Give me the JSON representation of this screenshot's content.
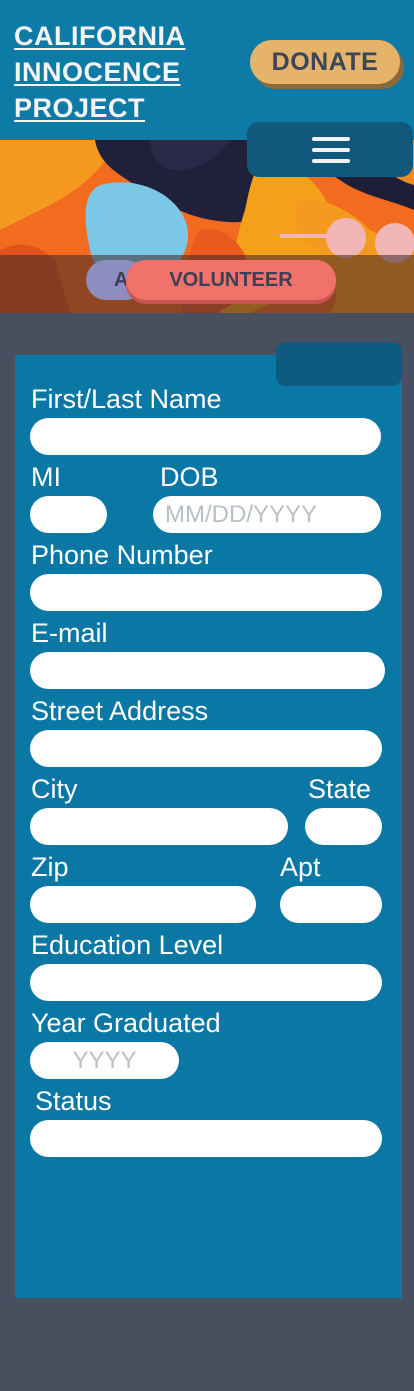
{
  "header": {
    "logo_lines": [
      "CALIFORNIA",
      "INNOCENCE",
      "PROJECT"
    ],
    "donate_label": "DONATE",
    "menu_icon": "hamburger-menu-icon"
  },
  "hero": {
    "tab_partial_label": "A",
    "volunteer_label": "VOLUNTEER"
  },
  "form": {
    "name_label": "First/Last Name",
    "mi_label": "MI",
    "dob_label": "DOB",
    "dob_placeholder": "MM/DD/YYYY",
    "phone_label": "Phone Number",
    "email_label": "E-mail",
    "street_label": "Street Address",
    "city_label": "City",
    "state_label": "State",
    "zip_label": "Zip",
    "apt_label": "Apt",
    "education_label": "Education Level",
    "year_label": "Year Graduated",
    "year_placeholder": "YYYY",
    "status_label": "Status"
  },
  "colors": {
    "background": "#484f5f",
    "header": "#0e7aa6",
    "panel": "#0b77a5",
    "donate": "#e6b36a",
    "volunteer": "#f0726a"
  }
}
